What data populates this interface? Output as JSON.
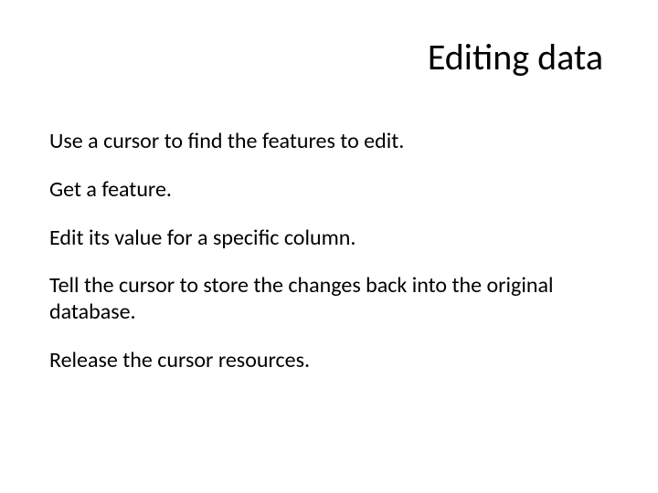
{
  "slide": {
    "title": "Editing data",
    "paragraphs": [
      "Use a cursor to find the features to edit.",
      "Get a feature.",
      "Edit its value for a specific column.",
      "Tell the cursor to store the changes back into the original database.",
      "Release the cursor resources."
    ]
  }
}
